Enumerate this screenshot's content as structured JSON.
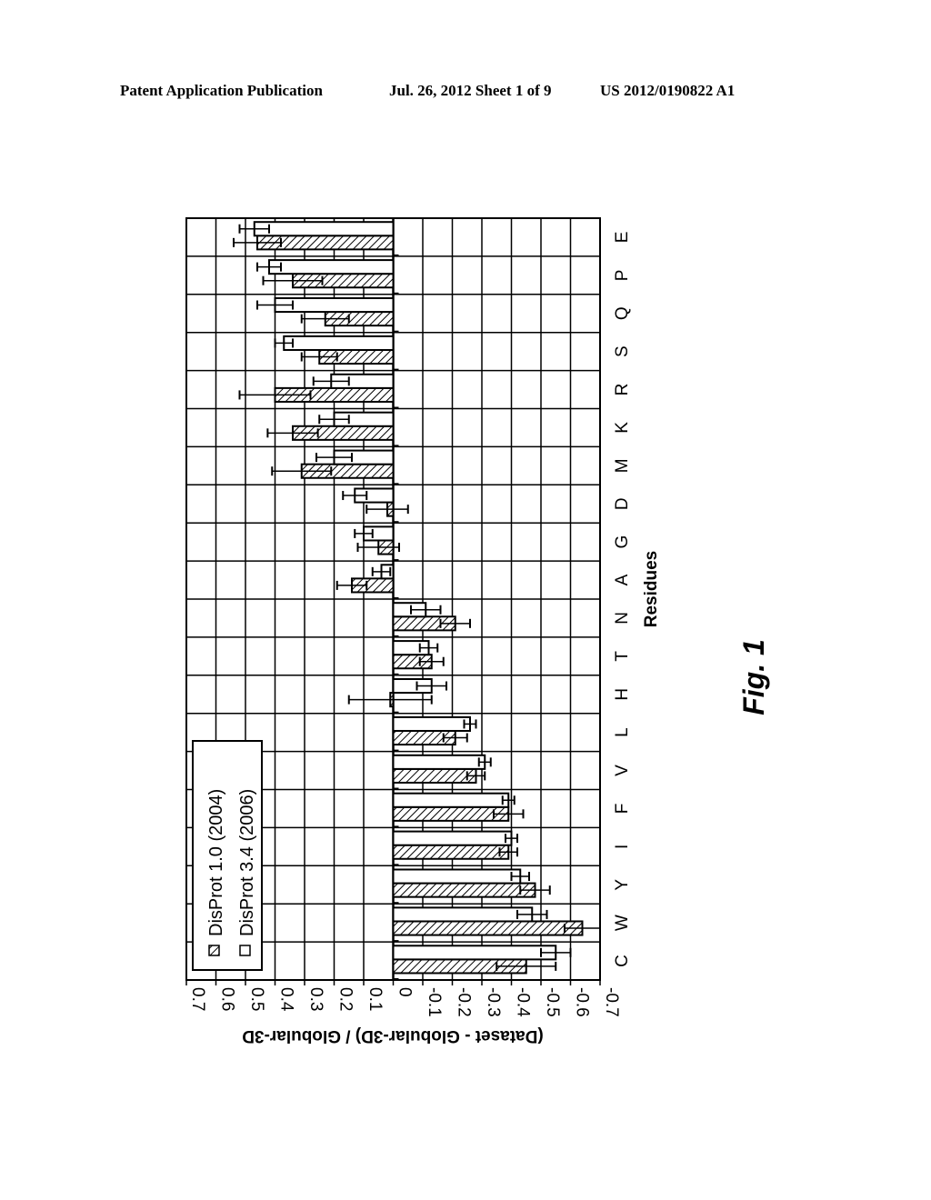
{
  "header": {
    "left": "Patent Application Publication",
    "middle": "Jul. 26, 2012   Sheet 1 of 9",
    "right": "US 2012/0190822 A1"
  },
  "figure_label": "Fig. 1",
  "chart_data": {
    "type": "bar",
    "orientation": "rotated-90-clockwise",
    "title": "",
    "xlabel": "Residues",
    "ylabel": "(Dataset - Globular-3D) / Globular-3D",
    "ylim": [
      -0.7,
      0.7
    ],
    "yticks": [
      "0.7",
      "0.6",
      "0.5",
      "0.4",
      "0.3",
      "0.2",
      "0.1",
      "0",
      "-0.1",
      "-0.2",
      "-0.3",
      "-0.4",
      "-0.5",
      "-0.6",
      "-0.7"
    ],
    "grid": true,
    "legend_position": "top-left",
    "categories": [
      "C",
      "W",
      "Y",
      "I",
      "F",
      "V",
      "L",
      "H",
      "T",
      "N",
      "A",
      "G",
      "D",
      "M",
      "K",
      "R",
      "S",
      "Q",
      "P",
      "E"
    ],
    "series": [
      {
        "name": "DisProt 1.0 (2004)",
        "pattern": "hatched",
        "values": [
          -0.45,
          -0.64,
          -0.48,
          -0.39,
          -0.39,
          -0.28,
          -0.21,
          0.01,
          -0.13,
          -0.21,
          0.14,
          0.05,
          0.02,
          0.31,
          0.34,
          0.4,
          0.25,
          0.23,
          0.34,
          0.46
        ],
        "errors": [
          0.1,
          0.06,
          0.05,
          0.03,
          0.05,
          0.03,
          0.04,
          0.14,
          0.04,
          0.05,
          0.05,
          0.07,
          0.07,
          0.1,
          0.085,
          0.12,
          0.06,
          0.08,
          0.1,
          0.08
        ]
      },
      {
        "name": "DisProt 3.4 (2006)",
        "pattern": "white",
        "values": [
          -0.55,
          -0.47,
          -0.43,
          -0.4,
          -0.39,
          -0.31,
          -0.26,
          -0.13,
          -0.12,
          -0.11,
          0.04,
          0.1,
          0.13,
          0.2,
          0.2,
          0.21,
          0.37,
          0.4,
          0.42,
          0.47
        ],
        "errors": [
          0.05,
          0.05,
          0.03,
          0.02,
          0.02,
          0.02,
          0.02,
          0.05,
          0.03,
          0.05,
          0.03,
          0.03,
          0.04,
          0.06,
          0.05,
          0.06,
          0.03,
          0.06,
          0.04,
          0.05
        ]
      }
    ]
  }
}
